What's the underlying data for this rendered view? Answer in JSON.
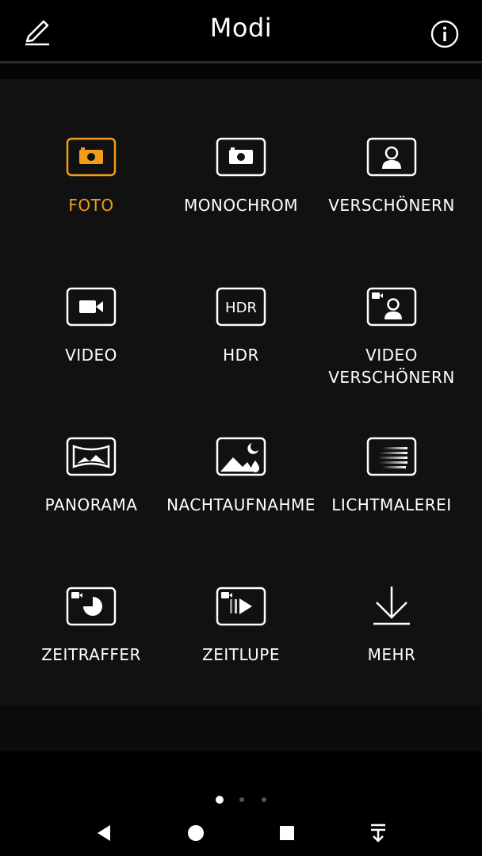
{
  "header": {
    "title": "Modi",
    "edit_icon": "pencil-icon",
    "info_icon": "info-icon"
  },
  "colors": {
    "accent": "#f39c1b",
    "text": "#ffffff",
    "panel": "#111111"
  },
  "modes": [
    {
      "label": "FOTO",
      "icon": "camera-icon",
      "active": true
    },
    {
      "label": "MONOCHROM",
      "icon": "camera-mono-icon",
      "active": false
    },
    {
      "label": "VERSCHÖNERN",
      "icon": "portrait-icon",
      "active": false
    },
    {
      "label": "VIDEO",
      "icon": "video-icon",
      "active": false
    },
    {
      "label": "HDR",
      "icon": "hdr-icon",
      "active": false
    },
    {
      "label": "VIDEO\nVERSCHÖNERN",
      "icon": "video-portrait-icon",
      "active": false
    },
    {
      "label": "PANORAMA",
      "icon": "panorama-icon",
      "active": false
    },
    {
      "label": "NACHTAUFNAHME",
      "icon": "night-icon",
      "active": false
    },
    {
      "label": "LICHTMALEREI",
      "icon": "light-painting-icon",
      "active": false
    },
    {
      "label": "ZEITRAFFER",
      "icon": "timelapse-icon",
      "active": false
    },
    {
      "label": "ZEITLUPE",
      "icon": "slow-motion-icon",
      "active": false
    },
    {
      "label": "MEHR",
      "icon": "download-icon",
      "active": false
    }
  ],
  "hdr_icon_text": "HDR",
  "page_indicator": {
    "count": 3,
    "current": 1
  },
  "navbar": {
    "back_icon": "back-triangle-icon",
    "home_icon": "home-circle-icon",
    "recent_icon": "recent-square-icon",
    "notification_icon": "notification-pull-down-icon"
  }
}
